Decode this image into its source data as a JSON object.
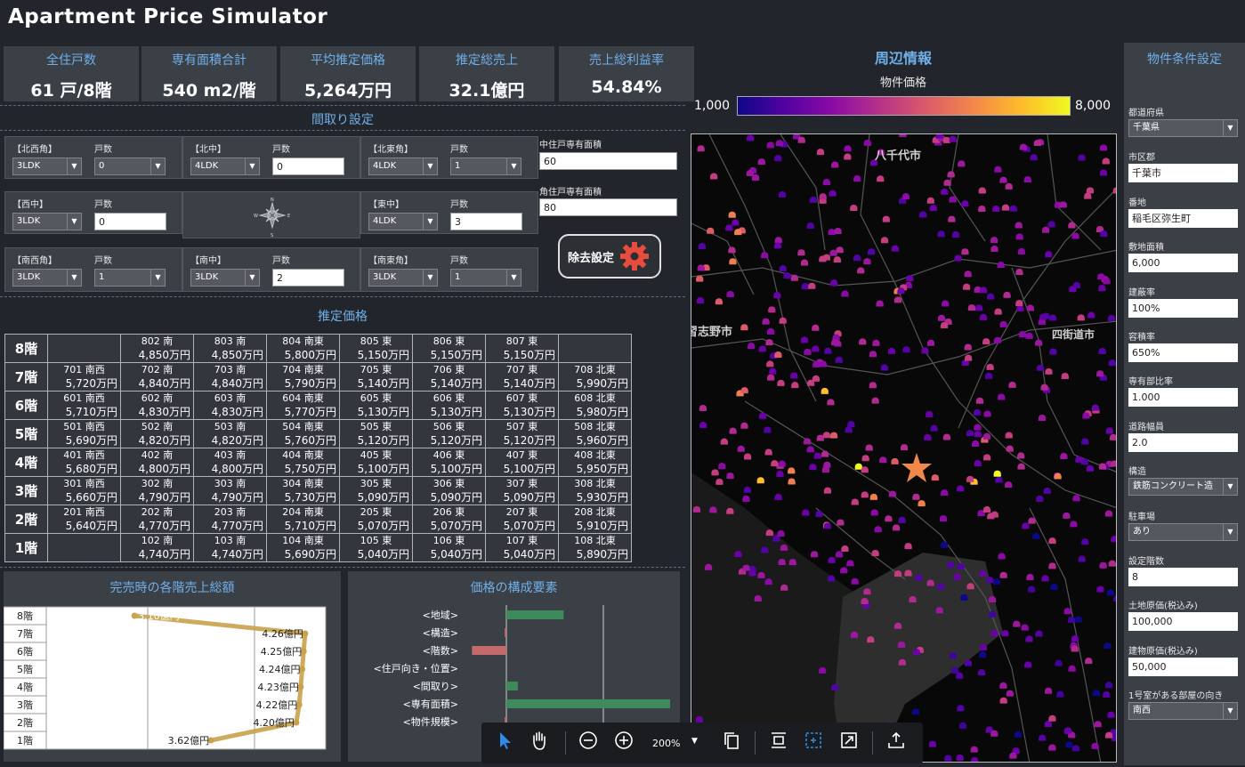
{
  "app": {
    "title": "Apartment Price Simulator"
  },
  "kpis": [
    {
      "label": "全住戸数",
      "value": "61 戸/8階"
    },
    {
      "label": "専有面積合計",
      "value": "540 m2/階"
    },
    {
      "label": "平均推定価格",
      "value": "5,264万円"
    },
    {
      "label": "推定総売上",
      "value": "32.1億円"
    },
    {
      "label": "売上総利益率",
      "value": "54.84%"
    }
  ],
  "layout_section": {
    "title": "間取り設定",
    "count_label": "戸数",
    "cells": [
      {
        "pos": "【北西角】",
        "plan": "3LDK",
        "count": "0",
        "count_style": "select"
      },
      {
        "pos": "【北中】",
        "plan": "4LDK",
        "count": "0",
        "count_style": "input"
      },
      {
        "pos": "【北東角】",
        "plan": "4LDK",
        "count": "1",
        "count_style": "select"
      },
      {
        "pos": "【西中】",
        "plan": "3LDK",
        "count": "0",
        "count_style": "input"
      },
      {
        "pos": "【東中】",
        "plan": "4LDK",
        "count": "3",
        "count_style": "input"
      },
      {
        "pos": "【南西角】",
        "plan": "3LDK",
        "count": "1",
        "count_style": "select"
      },
      {
        "pos": "【南中】",
        "plan": "3LDK",
        "count": "2",
        "count_style": "input"
      },
      {
        "pos": "【南東角】",
        "plan": "3LDK",
        "count": "1",
        "count_style": "select"
      }
    ],
    "compass": {
      "n": "N",
      "s": "S",
      "e": "E",
      "w": "W"
    },
    "mid_area_label": "中住戸専有面積",
    "mid_area_value": "60",
    "corner_area_label": "角住戸専有面積",
    "corner_area_value": "80",
    "remove_button": "除去設定"
  },
  "price_table": {
    "title": "推定価格",
    "rows": [
      {
        "floor": "8階",
        "units": [
          null,
          {
            "unit": "802 南",
            "price": "4,850万円"
          },
          {
            "unit": "803 南",
            "price": "4,850万円"
          },
          {
            "unit": "804 南東",
            "price": "5,800万円"
          },
          {
            "unit": "805 東",
            "price": "5,150万円"
          },
          {
            "unit": "806 東",
            "price": "5,150万円"
          },
          {
            "unit": "807 東",
            "price": "5,150万円"
          },
          null
        ]
      },
      {
        "floor": "7階",
        "units": [
          {
            "unit": "701 南西",
            "price": "5,720万円"
          },
          {
            "unit": "702 南",
            "price": "4,840万円"
          },
          {
            "unit": "703 南",
            "price": "4,840万円"
          },
          {
            "unit": "704 南東",
            "price": "5,790万円"
          },
          {
            "unit": "705 東",
            "price": "5,140万円"
          },
          {
            "unit": "706 東",
            "price": "5,140万円"
          },
          {
            "unit": "707 東",
            "price": "5,140万円"
          },
          {
            "unit": "708 北東",
            "price": "5,990万円"
          }
        ]
      },
      {
        "floor": "6階",
        "units": [
          {
            "unit": "601 南西",
            "price": "5,710万円"
          },
          {
            "unit": "602 南",
            "price": "4,830万円"
          },
          {
            "unit": "603 南",
            "price": "4,830万円"
          },
          {
            "unit": "604 南東",
            "price": "5,770万円"
          },
          {
            "unit": "605 東",
            "price": "5,130万円"
          },
          {
            "unit": "606 東",
            "price": "5,130万円"
          },
          {
            "unit": "607 東",
            "price": "5,130万円"
          },
          {
            "unit": "608 北東",
            "price": "5,980万円"
          }
        ]
      },
      {
        "floor": "5階",
        "units": [
          {
            "unit": "501 南西",
            "price": "5,690万円"
          },
          {
            "unit": "502 南",
            "price": "4,820万円"
          },
          {
            "unit": "503 南",
            "price": "4,820万円"
          },
          {
            "unit": "504 南東",
            "price": "5,760万円"
          },
          {
            "unit": "505 東",
            "price": "5,120万円"
          },
          {
            "unit": "506 東",
            "price": "5,120万円"
          },
          {
            "unit": "507 東",
            "price": "5,120万円"
          },
          {
            "unit": "508 北東",
            "price": "5,960万円"
          }
        ]
      },
      {
        "floor": "4階",
        "units": [
          {
            "unit": "401 南西",
            "price": "5,680万円"
          },
          {
            "unit": "402 南",
            "price": "4,800万円"
          },
          {
            "unit": "403 南",
            "price": "4,800万円"
          },
          {
            "unit": "404 南東",
            "price": "5,750万円"
          },
          {
            "unit": "405 東",
            "price": "5,100万円"
          },
          {
            "unit": "406 東",
            "price": "5,100万円"
          },
          {
            "unit": "407 東",
            "price": "5,100万円"
          },
          {
            "unit": "408 北東",
            "price": "5,950万円"
          }
        ]
      },
      {
        "floor": "3階",
        "units": [
          {
            "unit": "301 南西",
            "price": "5,660万円"
          },
          {
            "unit": "302 南",
            "price": "4,790万円"
          },
          {
            "unit": "303 南",
            "price": "4,790万円"
          },
          {
            "unit": "304 南東",
            "price": "5,730万円"
          },
          {
            "unit": "305 東",
            "price": "5,090万円"
          },
          {
            "unit": "306 東",
            "price": "5,090万円"
          },
          {
            "unit": "307 東",
            "price": "5,090万円"
          },
          {
            "unit": "308 北東",
            "price": "5,930万円"
          }
        ]
      },
      {
        "floor": "2階",
        "units": [
          {
            "unit": "201 南西",
            "price": "5,640万円"
          },
          {
            "unit": "202 南",
            "price": "4,770万円"
          },
          {
            "unit": "203 南",
            "price": "4,770万円"
          },
          {
            "unit": "204 南東",
            "price": "5,710万円"
          },
          {
            "unit": "205 東",
            "price": "5,070万円"
          },
          {
            "unit": "206 東",
            "price": "5,070万円"
          },
          {
            "unit": "207 東",
            "price": "5,070万円"
          },
          {
            "unit": "208 北東",
            "price": "5,910万円"
          }
        ]
      },
      {
        "floor": "1階",
        "units": [
          null,
          {
            "unit": "102 南",
            "price": "4,740万円"
          },
          {
            "unit": "103 南",
            "price": "4,740万円"
          },
          {
            "unit": "104 南東",
            "price": "5,690万円"
          },
          {
            "unit": "105 東",
            "price": "5,040万円"
          },
          {
            "unit": "106 東",
            "price": "5,040万円"
          },
          {
            "unit": "107 東",
            "price": "5,040万円"
          },
          {
            "unit": "108 北東",
            "price": "5,890万円"
          }
        ]
      }
    ]
  },
  "chart_data": [
    {
      "type": "line",
      "title": "完売時の各階売上総額",
      "categories": [
        "8階",
        "7階",
        "6階",
        "5階",
        "4階",
        "3階",
        "2階",
        "1階"
      ],
      "values": [
        3.1,
        4.26,
        4.25,
        4.24,
        4.23,
        4.22,
        4.2,
        3.62
      ],
      "labels": [
        "3.10億円",
        "4.26億円",
        "4.25億円",
        "4.24億円",
        "4.23億円",
        "4.22億円",
        "4.20億円",
        "3.62億円"
      ],
      "color": "#c9a24a"
    },
    {
      "type": "bar",
      "title": "価格の構成要素",
      "categories": [
        "<地域>",
        "<構造>",
        "<階数>",
        "<住戸向き・位置>",
        "<間取り>",
        "<専有面積>",
        "<物件規模>"
      ],
      "values": [
        0.35,
        -0.01,
        -0.21,
        0.0,
        0.07,
        1.0,
        -0.01
      ],
      "positive_color": "#3d8a5a",
      "negative_color": "#c46a6a"
    }
  ],
  "map": {
    "title": "周辺情報",
    "legend_title": "物件価格",
    "legend_min": "1,000",
    "legend_max": "8,000",
    "labels": [
      "八千代市",
      "習志野市",
      "四街道市"
    ]
  },
  "toolbar": {
    "zoom": "200%"
  },
  "conditions": {
    "title": "物件条件設定",
    "fields": [
      {
        "label": "都道府県",
        "value": "千葉県",
        "type": "select"
      },
      {
        "label": "市区郡",
        "value": "千葉市",
        "type": "input"
      },
      {
        "label": "番地",
        "value": "稲毛区弥生町",
        "type": "input"
      },
      {
        "label": "敷地面積",
        "value": "6,000",
        "type": "input"
      },
      {
        "label": "建蔽率",
        "value": "100%",
        "type": "input"
      },
      {
        "label": "容積率",
        "value": "650%",
        "type": "input"
      },
      {
        "label": "専有部比率",
        "value": "1.000",
        "type": "input"
      },
      {
        "label": "道路幅員",
        "value": "2.0",
        "type": "input"
      },
      {
        "label": "構造",
        "value": "鉄筋コンクリート造",
        "type": "select"
      },
      {
        "label": "駐車場",
        "value": "あり",
        "type": "select"
      },
      {
        "label": "設定階数",
        "value": "8",
        "type": "input"
      },
      {
        "label": "土地原価(税込み)",
        "value": "100,000",
        "type": "input"
      },
      {
        "label": "建物原価(税込み)",
        "value": "50,000",
        "type": "input"
      },
      {
        "label": "1号室がある部屋の向き",
        "value": "南西",
        "type": "select"
      }
    ]
  }
}
